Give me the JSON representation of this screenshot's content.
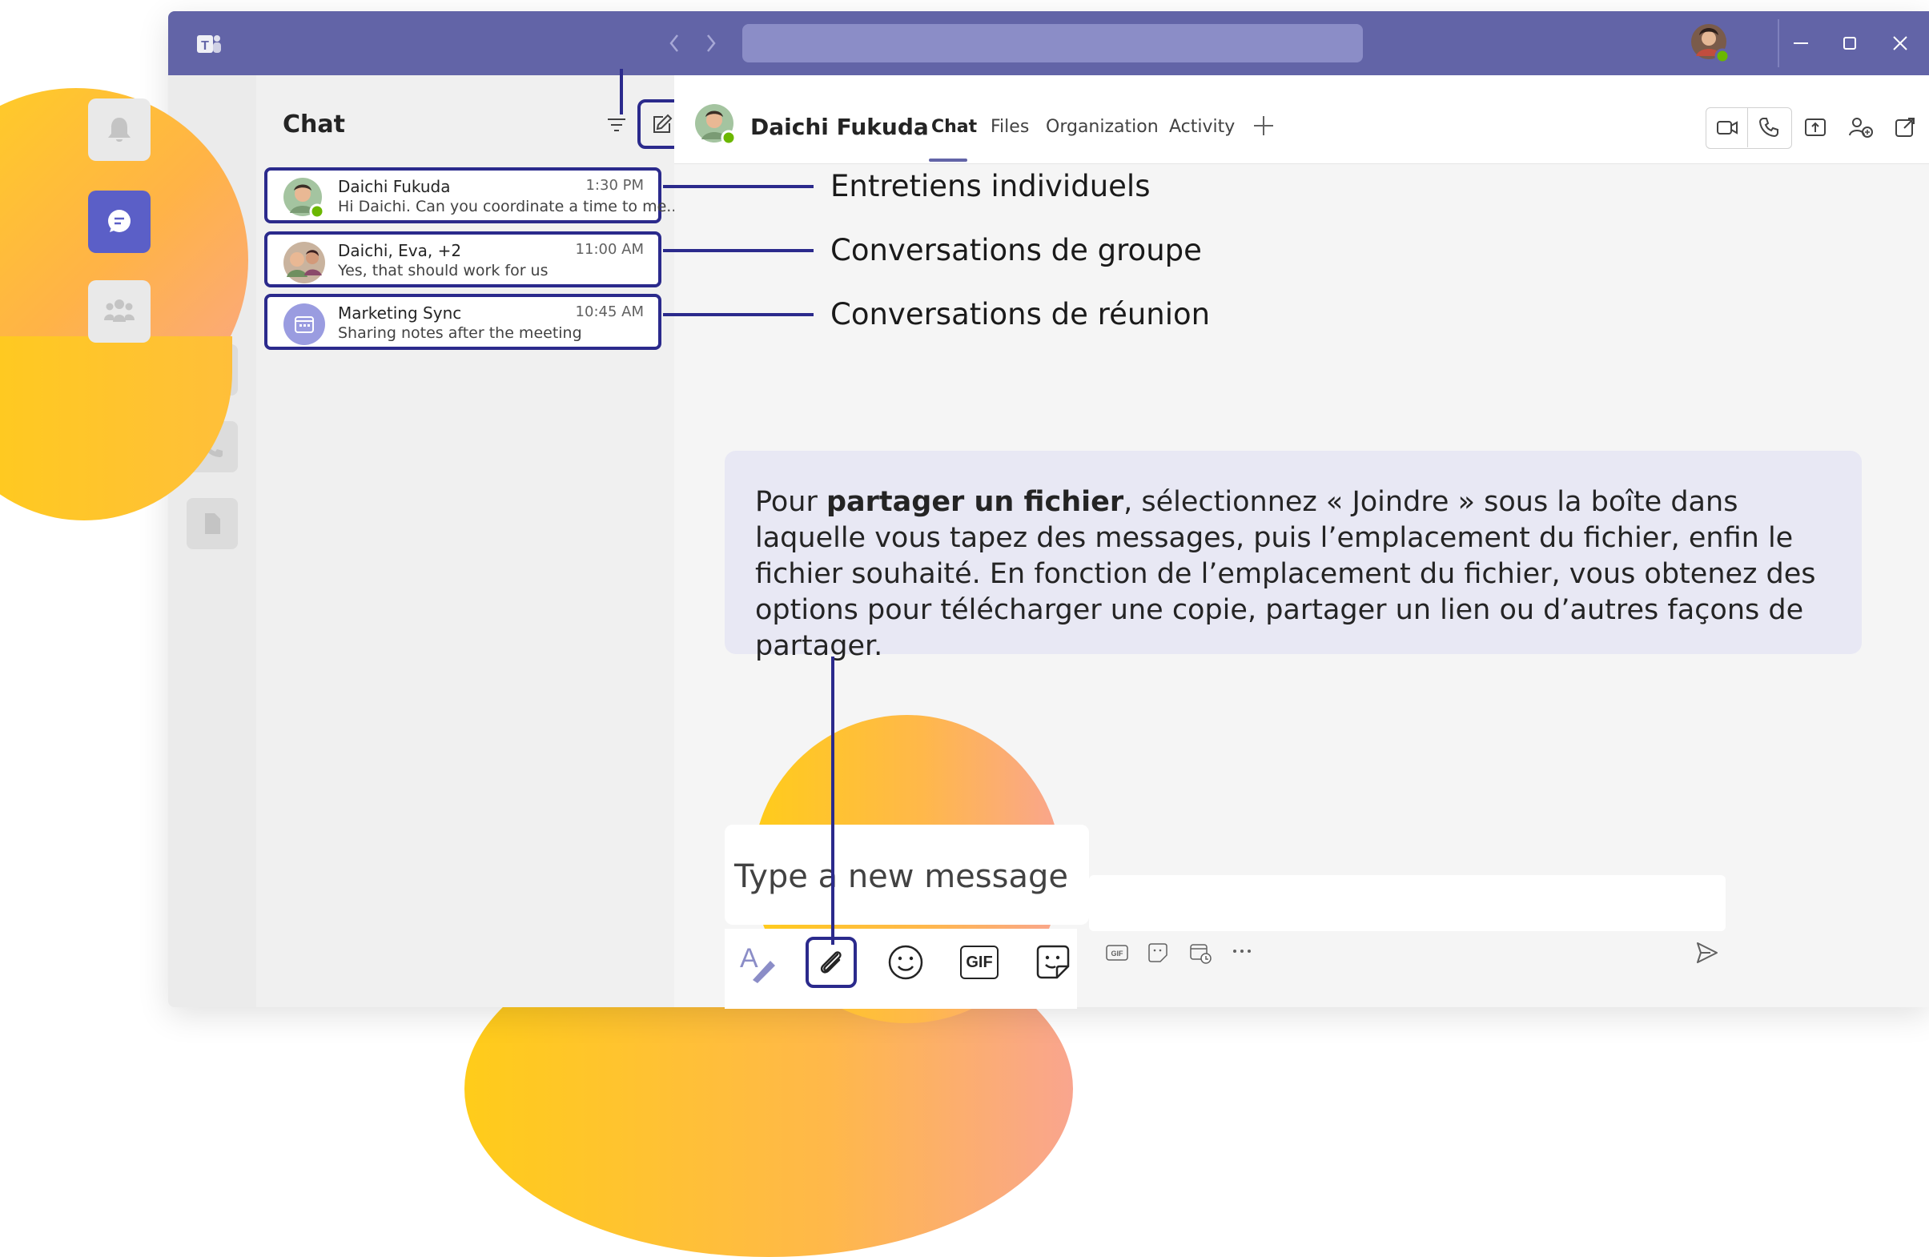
{
  "chat_list": {
    "title": "Chat",
    "items": [
      {
        "name": "Daichi Fukuda",
        "time": "1:30 PM",
        "preview": "Hi Daichi. Can you coordinate a time to me..."
      },
      {
        "name": "Daichi, Eva, +2",
        "time": "11:00 AM",
        "preview": "Yes, that should work for us"
      },
      {
        "name": "Marketing Sync",
        "time": "10:45 AM",
        "preview": "Sharing notes after the meeting"
      }
    ]
  },
  "conversation": {
    "name": "Daichi Fukuda",
    "tabs": [
      {
        "label": "Chat"
      },
      {
        "label": "Files"
      },
      {
        "label": "Organization"
      },
      {
        "label": "Activity"
      }
    ]
  },
  "annotations": {
    "one_on_one": "Entretiens individuels",
    "group": "Conversations de groupe",
    "meeting": "Conversations de réunion"
  },
  "callout": {
    "part1": "Pour ",
    "bold": "partager un fichier",
    "part2": ", sélectionnez « Joindre » sous la boîte dans laquelle vous tapez des messages, puis l’emplacement du fichier, enfin le fichier souhaité. En fonction de l’emplacement du fichier, vous obtenez des options pour télécharger une copie, partager un lien ou d’autres façons de partager."
  },
  "compose": {
    "placeholder": "Type a new message",
    "gif_label": "GIF"
  },
  "colors": {
    "brand": "#6264a7",
    "highlight": "#2b2a8c",
    "presence": "#6bb700"
  }
}
